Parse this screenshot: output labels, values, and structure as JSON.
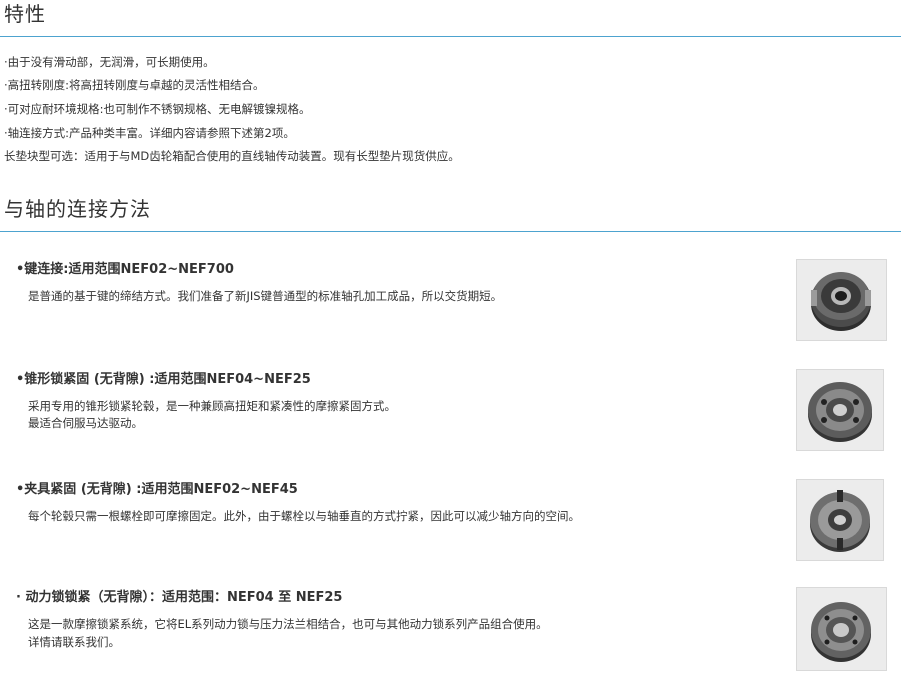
{
  "features": {
    "title": "特性",
    "items": [
      "·由于没有滑动部，无润滑，可长期使用。",
      "·高扭转刚度:将高扭转刚度与卓越的灵活性相结合。",
      "·可对应耐环境规格:也可制作不锈钢规格、无电解镀镍规格。",
      "·轴连接方式:产品种类丰富。详细内容请参照下述第2项。",
      "长垫块型可选：适用于与MD齿轮箱配合使用的直线轴传动装置。现有长型垫片现货供应。"
    ]
  },
  "methods": {
    "title": "与轴的连接方法",
    "items": [
      {
        "title": "•键连接:适用范围NEF02~NEF700",
        "desc": [
          "是普通的基于键的缔结方式。我们准备了新JIS键普通型的标准轴孔加工成品，所以交货期短。"
        ],
        "image_icon": "coupling-key-image"
      },
      {
        "title": "•锥形锁紧固 (无背隙) :适用范围NEF04~NEF25",
        "desc": [
          "采用专用的锥形锁紧轮毂，是一种兼顾高扭矩和紧凑性的摩擦紧固方式。",
          "最适合伺服马达驱动。"
        ],
        "image_icon": "coupling-taper-lock-image"
      },
      {
        "title": "•夹具紧固 (无背隙) :适用范围NEF02~NEF45",
        "desc": [
          "每个轮毂只需一根螺栓即可摩擦固定。此外，由于螺栓以与轴垂直的方式拧紧，因此可以减少轴方向的空间。"
        ],
        "image_icon": "coupling-clamp-image"
      },
      {
        "title": "· 动力锁锁紧（无背隙）：适用范围：NEF04 至 NEF25",
        "desc": [
          "这是一款摩擦锁紧系统，它将EL系列动力锁与压力法兰相结合，也可与其他动力锁系列产品组合使用。",
          "详情请联系我们。"
        ],
        "image_icon": "coupling-power-lock-image"
      }
    ]
  },
  "colors": {
    "rule": "#4da3cf",
    "text": "#333333",
    "thumb_bg": "#efefef"
  }
}
